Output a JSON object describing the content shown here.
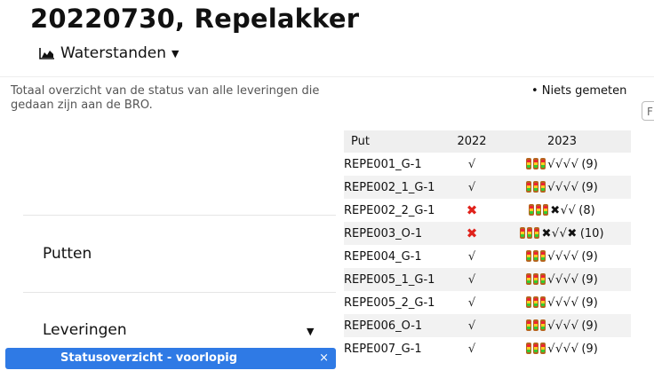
{
  "page": {
    "title": "20220730, Repelakker",
    "section_dropdown": {
      "icon": "area-chart-icon",
      "label": "Waterstanden"
    }
  },
  "description": "Totaal overzicht van de status van alle leveringen die gedaan zijn aan de BRO.",
  "legend": "• Niets gemeten",
  "filter_stub": "F",
  "sidebar": {
    "putten_label": "Putten",
    "leveringen_label": "Leveringen",
    "selected_option": "Statusoverzicht - voorlopig",
    "remove_symbol": "×"
  },
  "table": {
    "headers": {
      "put": "Put",
      "y2022": "2022",
      "y2023": "2023"
    },
    "rows": [
      {
        "put": "REPE001_G-1",
        "y2022": "√",
        "ok2022": true,
        "marks": "√√√√",
        "count": "(9)"
      },
      {
        "put": "REPE002_1_G-1",
        "y2022": "√",
        "ok2022": true,
        "marks": "√√√√",
        "count": "(9)"
      },
      {
        "put": "REPE002_2_G-1",
        "y2022": "✖",
        "ok2022": false,
        "marks": "✖√√",
        "count": "(8)"
      },
      {
        "put": "REPE003_O-1",
        "y2022": "✖",
        "ok2022": false,
        "marks": "✖√√✖",
        "count": "(10)"
      },
      {
        "put": "REPE004_G-1",
        "y2022": "√",
        "ok2022": true,
        "marks": "√√√√",
        "count": "(9)"
      },
      {
        "put": "REPE005_1_G-1",
        "y2022": "√",
        "ok2022": true,
        "marks": "√√√√",
        "count": "(9)"
      },
      {
        "put": "REPE005_2_G-1",
        "y2022": "√",
        "ok2022": true,
        "marks": "√√√√",
        "count": "(9)"
      },
      {
        "put": "REPE006_O-1",
        "y2022": "√",
        "ok2022": true,
        "marks": "√√√√",
        "count": "(9)"
      },
      {
        "put": "REPE007_G-1",
        "y2022": "√",
        "ok2022": true,
        "marks": "√√√√",
        "count": "(9)"
      }
    ]
  },
  "colors": {
    "selected": "#2f7ae5",
    "error": "#e0221b",
    "stripe": "#f2f2f2"
  }
}
